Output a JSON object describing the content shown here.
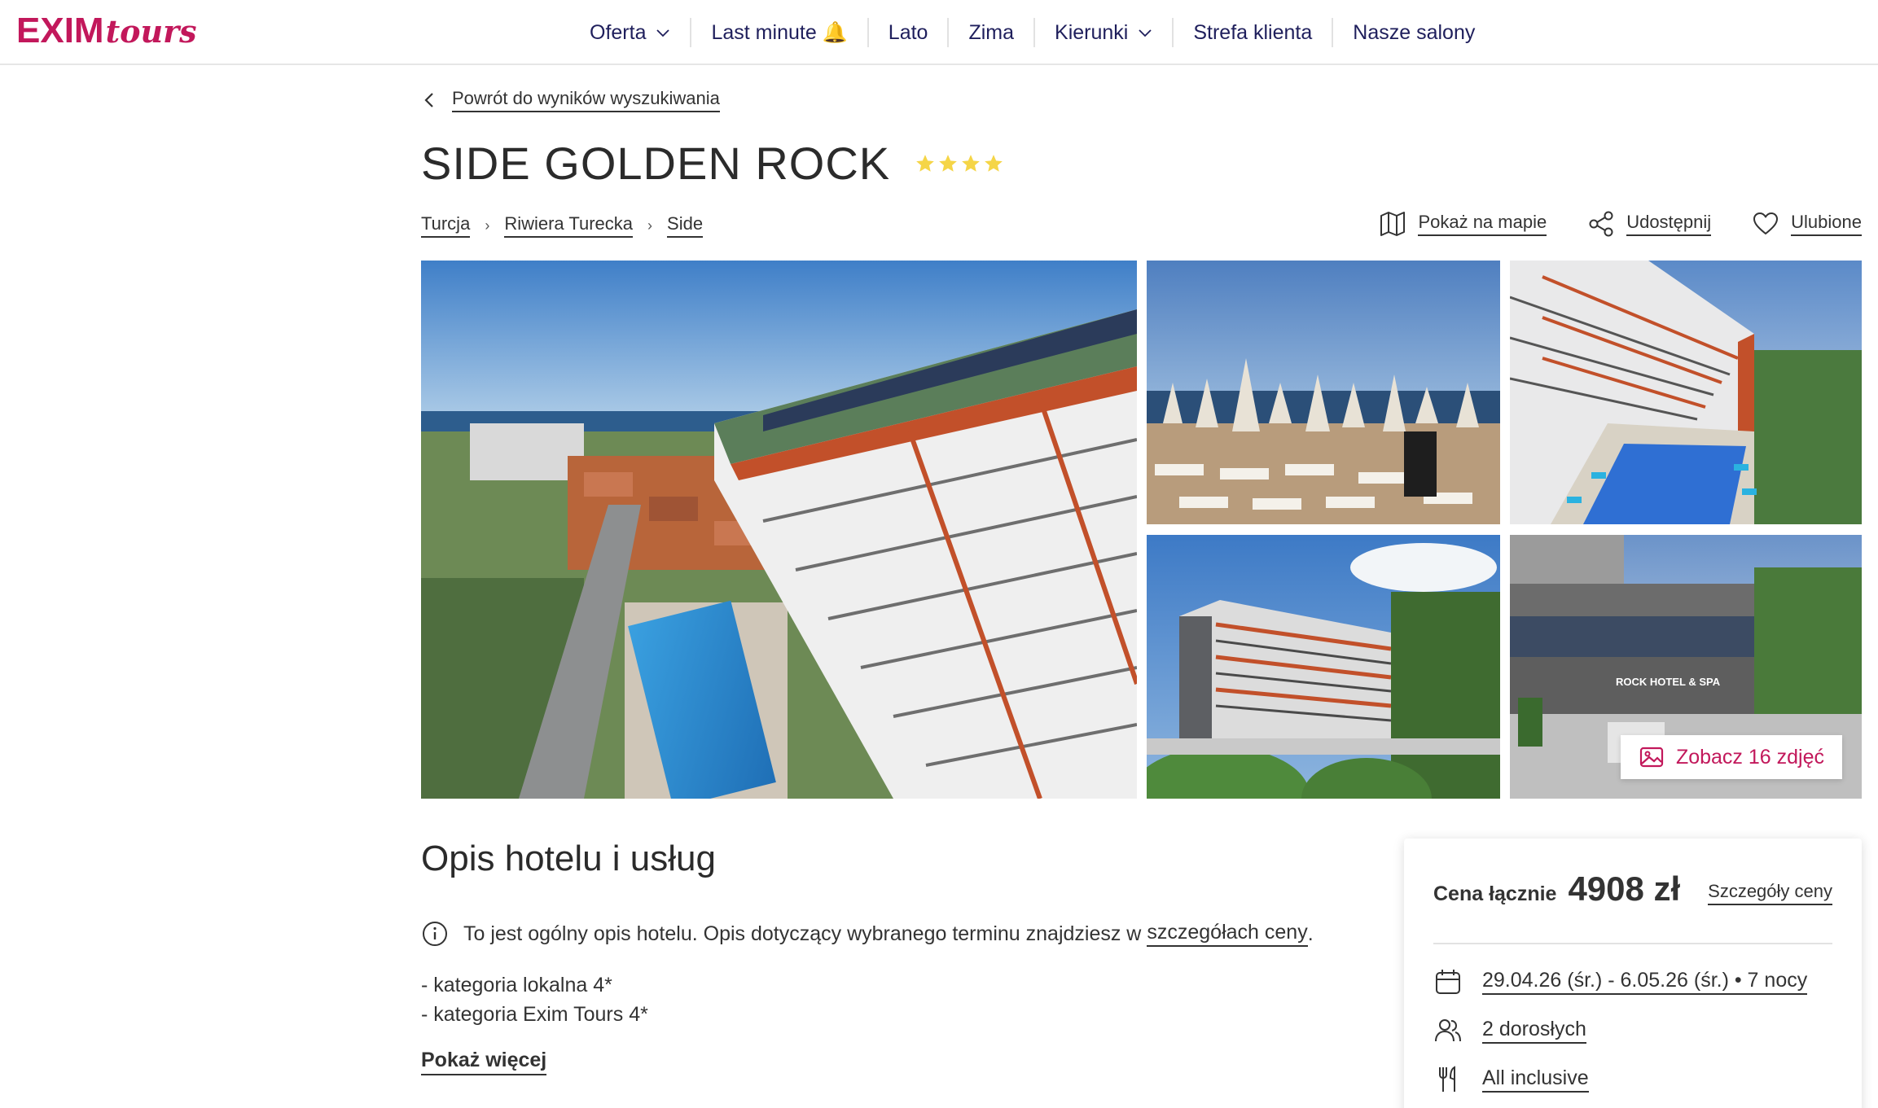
{
  "brand": {
    "name_main": "EXIM",
    "name_script": "tours",
    "color": "#c2185b"
  },
  "nav": {
    "items": [
      {
        "label": "Oferta",
        "has_dropdown": true
      },
      {
        "label": "Last minute 🔔",
        "has_dropdown": false
      },
      {
        "label": "Lato",
        "has_dropdown": false
      },
      {
        "label": "Zima",
        "has_dropdown": false
      },
      {
        "label": "Kierunki",
        "has_dropdown": true
      },
      {
        "label": "Strefa klienta",
        "has_dropdown": false
      },
      {
        "label": "Nasze salony",
        "has_dropdown": false
      }
    ]
  },
  "back_link": {
    "label": "Powrót do wyników wyszukiwania"
  },
  "hotel": {
    "name": "SIDE GOLDEN ROCK",
    "stars": 4,
    "star_color": "#f5d547"
  },
  "breadcrumb": [
    "Turcja",
    "Riwiera Turecka",
    "Side"
  ],
  "actions": {
    "map": "Pokaż na mapie",
    "share": "Udostępnij",
    "favorite": "Ulubione"
  },
  "gallery": {
    "photos": [
      {
        "icon": "hotel-aerial-photo"
      },
      {
        "icon": "beach-umbrellas-photo"
      },
      {
        "icon": "pool-building-photo"
      },
      {
        "icon": "hotel-building-photo"
      },
      {
        "icon": "hotel-entrance-photo"
      }
    ],
    "entrance_sign": "ROCK HOTEL & SPA",
    "more_photos_label": "Zobacz 16 zdjęć"
  },
  "description": {
    "title": "Opis hotelu i usług",
    "info_text_before": "To jest ogólny opis hotelu. Opis dotyczący wybranego terminu znajdziesz w",
    "info_link": "szczegółach ceny",
    "info_text_after": ".",
    "categories": [
      "- kategoria lokalna 4*",
      "- kategoria Exim Tours 4*"
    ],
    "show_more": "Pokaż więcej"
  },
  "price": {
    "label": "Cena łącznie",
    "value": "4908 zł",
    "details_link": "Szczegóły ceny",
    "dates": "29.04.26 (śr.) - 6.05.26 (śr.) • 7 nocy",
    "travelers": "2 dorosłych",
    "board": "All inclusive"
  }
}
